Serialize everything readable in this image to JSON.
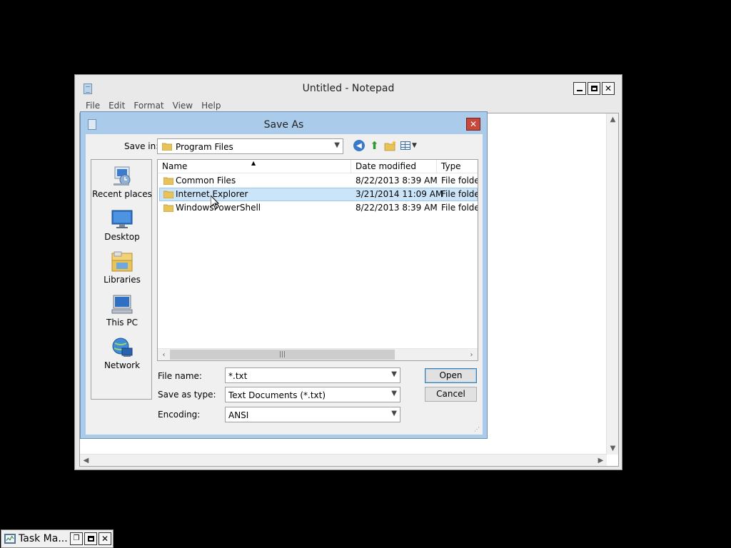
{
  "notepad": {
    "title": "Untitled - Notepad",
    "menu": [
      "File",
      "Edit",
      "Format",
      "View",
      "Help"
    ],
    "controls": {
      "minimize": "",
      "maximize": "",
      "close": "✕"
    }
  },
  "dialog": {
    "title": "Save As",
    "close": "✕",
    "save_in_label": "Save in:",
    "save_in_value": "Program Files",
    "places": [
      {
        "label": "Recent places",
        "icon": "recent-places-icon"
      },
      {
        "label": "Desktop",
        "icon": "desktop-icon"
      },
      {
        "label": "Libraries",
        "icon": "libraries-icon"
      },
      {
        "label": "This PC",
        "icon": "this-pc-icon"
      },
      {
        "label": "Network",
        "icon": "network-icon"
      }
    ],
    "columns": {
      "name": "Name",
      "date": "Date modified",
      "type": "Type"
    },
    "files": [
      {
        "name": "Common Files",
        "date": "8/22/2013 8:39 AM",
        "type": "File folder"
      },
      {
        "name": "Internet Explorer",
        "date": "3/21/2014 11:09 AM",
        "type": "File folder"
      },
      {
        "name": "WindowsPowerShell",
        "date": "8/22/2013 8:39 AM",
        "type": "File folder"
      }
    ],
    "selected_index": 1,
    "file_name_label": "File name:",
    "file_name_value": "*.txt",
    "save_type_label": "Save as type:",
    "save_type_value": "Text Documents (*.txt)",
    "encoding_label": "Encoding:",
    "encoding_value": "ANSI",
    "open_button": "Open",
    "cancel_button": "Cancel"
  },
  "taskbar": {
    "label": "Task Ma..."
  },
  "colors": {
    "dialog_frame": "#aacbe9",
    "selection": "#cce4f7",
    "close_red": "#c7483c"
  }
}
